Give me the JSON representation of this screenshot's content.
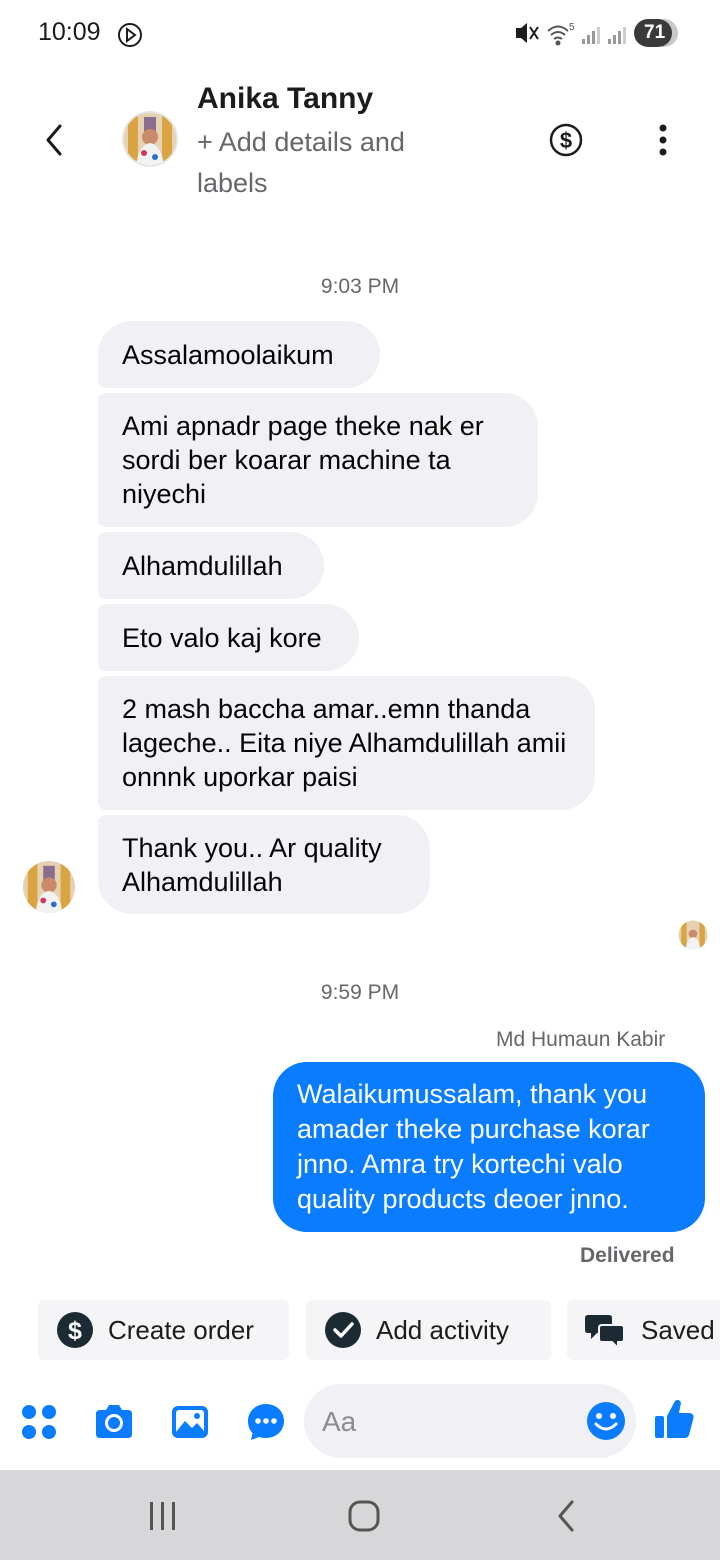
{
  "status_bar": {
    "time": "10:09",
    "battery": "71"
  },
  "header": {
    "contact_name": "Anika Tanny",
    "add_details": "+ Add details and labels",
    "icons": [
      "back-arrow-icon",
      "dollar-circle-icon",
      "more-vert-icon"
    ]
  },
  "conversation": {
    "timestamp_1": "9:03 PM",
    "incoming": [
      "Assalamoolaikum",
      "Ami apnadr page theke nak er sordi ber koarar machine ta niyechi",
      "Alhamdulillah",
      "Eto valo kaj kore",
      "2 mash baccha amar..emn thanda lageche.. Eita niye Alhamdulillah amii onnnk uporkar paisi",
      "Thank you.. Ar quality Alhamdulillah"
    ],
    "timestamp_2": "9:59 PM",
    "sender_name": "Md Humaun Kabir",
    "outgoing": "Walaikumussalam, thank you amader theke purchase korar jnno. Amra try kortechi valo quality products deoer jnno.",
    "status": "Delivered"
  },
  "quick_actions": {
    "create_order": "Create order",
    "add_activity": "Add activity",
    "saved": "Saved"
  },
  "composer": {
    "placeholder": "Aa",
    "icons": [
      "apps-icon",
      "camera-icon",
      "gallery-icon",
      "chat-bubble-icon",
      "emoji-icon",
      "like-icon"
    ]
  },
  "colors": {
    "accent": "#0a7cff",
    "incoming_bubble": "#f0f0f5",
    "muted_text": "#65676b",
    "nav_bar": "#d7d7da"
  }
}
